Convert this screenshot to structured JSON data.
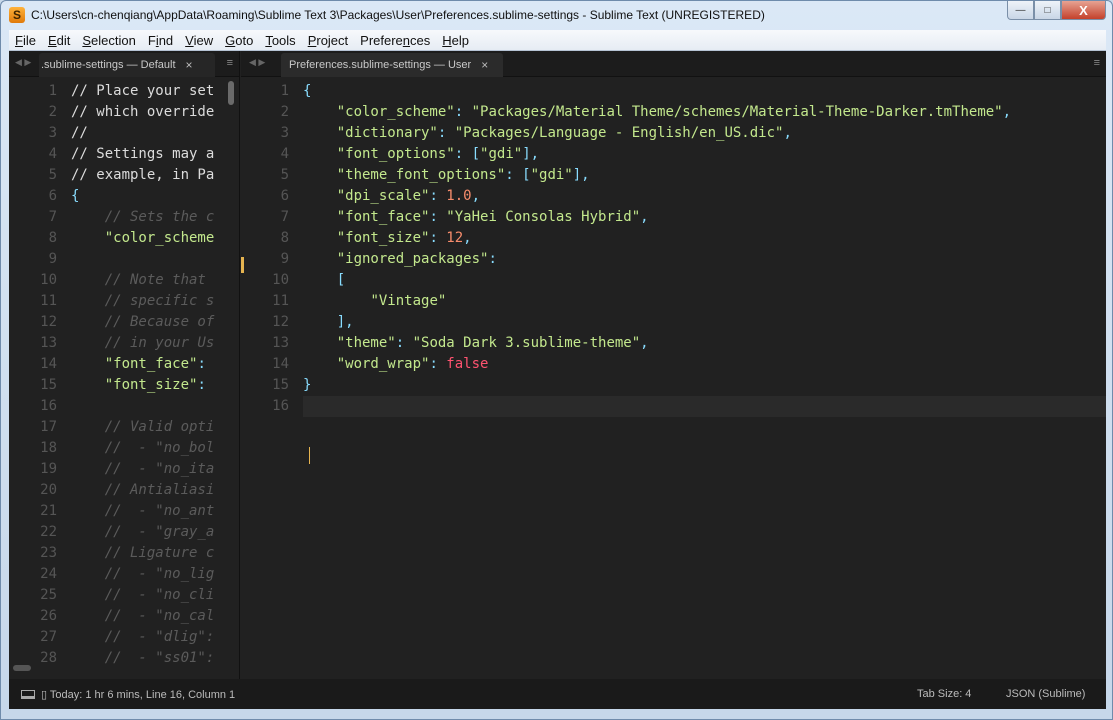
{
  "window": {
    "title": "C:\\Users\\cn-chenqiang\\AppData\\Roaming\\Sublime Text 3\\Packages\\User\\Preferences.sublime-settings - Sublime Text (UNREGISTERED)",
    "app_icon_letter": "S",
    "minimize_label": "—",
    "maximize_label": "□",
    "close_label": "X"
  },
  "menu": [
    {
      "ul": "F",
      "rest": "ile"
    },
    {
      "ul": "E",
      "rest": "dit"
    },
    {
      "ul": "S",
      "rest": "election"
    },
    {
      "pre": "F",
      "ul": "i",
      "rest": "nd"
    },
    {
      "ul": "V",
      "rest": "iew"
    },
    {
      "ul": "G",
      "rest": "oto"
    },
    {
      "ul": "T",
      "rest": "ools"
    },
    {
      "ul": "P",
      "rest": "roject"
    },
    {
      "pre": "Prefere",
      "ul": "n",
      "rest": "ces"
    },
    {
      "ul": "H",
      "rest": "elp"
    }
  ],
  "left_pane": {
    "tab_label": ".sublime-settings — Default",
    "tab_close": "×",
    "nav": "◀ ▶",
    "menu_icon": "≡",
    "line_numbers": [
      "1",
      "2",
      "3",
      "4",
      "5",
      "6",
      "7",
      "8",
      "9",
      "10",
      "11",
      "12",
      "13",
      "14",
      "15",
      "16",
      "17",
      "18",
      "19",
      "20",
      "21",
      "22",
      "23",
      "24",
      "25",
      "26",
      "27",
      "28"
    ],
    "lines": [
      [
        {
          "t": "// Place your set",
          "c": "commentplain"
        }
      ],
      [
        {
          "t": "// which override",
          "c": "commentplain"
        }
      ],
      [
        {
          "t": "//",
          "c": "commentplain"
        }
      ],
      [
        {
          "t": "// Settings may a",
          "c": "commentplain"
        }
      ],
      [
        {
          "t": "// example, in Pa",
          "c": "commentplain"
        }
      ],
      [
        {
          "t": "{",
          "c": "punct"
        }
      ],
      [
        {
          "t": "    // Sets the c",
          "c": "comment"
        }
      ],
      [
        {
          "t": "    ",
          "c": "text"
        },
        {
          "t": "\"color_scheme",
          "c": "string"
        }
      ],
      [
        {
          "t": "",
          "c": "text"
        }
      ],
      [
        {
          "t": "    // Note that ",
          "c": "comment"
        }
      ],
      [
        {
          "t": "    // specific s",
          "c": "comment"
        }
      ],
      [
        {
          "t": "    // Because of",
          "c": "comment"
        }
      ],
      [
        {
          "t": "    // in your Us",
          "c": "comment"
        }
      ],
      [
        {
          "t": "    ",
          "c": "text"
        },
        {
          "t": "\"font_face\"",
          "c": "string"
        },
        {
          "t": ":",
          "c": "punct"
        }
      ],
      [
        {
          "t": "    ",
          "c": "text"
        },
        {
          "t": "\"font_size\"",
          "c": "string"
        },
        {
          "t": ":",
          "c": "punct"
        }
      ],
      [
        {
          "t": "",
          "c": "text"
        }
      ],
      [
        {
          "t": "    // Valid opti",
          "c": "comment"
        }
      ],
      [
        {
          "t": "    //  - \"no_bol",
          "c": "comment"
        }
      ],
      [
        {
          "t": "    //  - \"no_ita",
          "c": "comment"
        }
      ],
      [
        {
          "t": "    // Antialiasi",
          "c": "comment"
        }
      ],
      [
        {
          "t": "    //  - \"no_ant",
          "c": "comment"
        }
      ],
      [
        {
          "t": "    //  - \"gray_a",
          "c": "comment"
        }
      ],
      [
        {
          "t": "    // Ligature c",
          "c": "comment"
        }
      ],
      [
        {
          "t": "    //  - \"no_lig",
          "c": "comment"
        }
      ],
      [
        {
          "t": "    //  - \"no_cli",
          "c": "comment"
        }
      ],
      [
        {
          "t": "    //  - \"no_cal",
          "c": "comment"
        }
      ],
      [
        {
          "t": "    //  - \"dlig\":",
          "c": "comment"
        }
      ],
      [
        {
          "t": "    //  - \"ss01\":",
          "c": "comment"
        }
      ]
    ]
  },
  "right_pane": {
    "tab_label": "Preferences.sublime-settings — User",
    "tab_close": "×",
    "nav": "◀ ▶",
    "menu_icon": "≡",
    "line_numbers": [
      "1",
      "2",
      "3",
      "4",
      "5",
      "6",
      "7",
      "8",
      "9",
      "10",
      "11",
      "12",
      "13",
      "14",
      "15",
      "16"
    ],
    "current_line": 16,
    "lines": [
      [
        {
          "t": "{",
          "c": "punct"
        }
      ],
      [
        {
          "t": "    ",
          "c": "text"
        },
        {
          "t": "\"color_scheme\"",
          "c": "string"
        },
        {
          "t": ": ",
          "c": "punct"
        },
        {
          "t": "\"Packages/Material Theme/schemes/Material-Theme-Darker.tmTheme\"",
          "c": "string"
        },
        {
          "t": ",",
          "c": "punct"
        }
      ],
      [
        {
          "t": "    ",
          "c": "text"
        },
        {
          "t": "\"dictionary\"",
          "c": "string"
        },
        {
          "t": ": ",
          "c": "punct"
        },
        {
          "t": "\"Packages/Language - English/en_US.dic\"",
          "c": "string"
        },
        {
          "t": ",",
          "c": "punct"
        }
      ],
      [
        {
          "t": "    ",
          "c": "text"
        },
        {
          "t": "\"font_options\"",
          "c": "string"
        },
        {
          "t": ": [",
          "c": "punct"
        },
        {
          "t": "\"gdi\"",
          "c": "string"
        },
        {
          "t": "],",
          "c": "punct"
        }
      ],
      [
        {
          "t": "    ",
          "c": "text"
        },
        {
          "t": "\"theme_font_options\"",
          "c": "string"
        },
        {
          "t": ": [",
          "c": "punct"
        },
        {
          "t": "\"gdi\"",
          "c": "string"
        },
        {
          "t": "],",
          "c": "punct"
        }
      ],
      [
        {
          "t": "    ",
          "c": "text"
        },
        {
          "t": "\"dpi_scale\"",
          "c": "string"
        },
        {
          "t": ": ",
          "c": "punct"
        },
        {
          "t": "1.0",
          "c": "number"
        },
        {
          "t": ",",
          "c": "punct"
        }
      ],
      [
        {
          "t": "    ",
          "c": "text"
        },
        {
          "t": "\"font_face\"",
          "c": "string"
        },
        {
          "t": ": ",
          "c": "punct"
        },
        {
          "t": "\"YaHei Consolas Hybrid\"",
          "c": "string"
        },
        {
          "t": ",",
          "c": "punct"
        }
      ],
      [
        {
          "t": "    ",
          "c": "text"
        },
        {
          "t": "\"font_size\"",
          "c": "string"
        },
        {
          "t": ": ",
          "c": "punct"
        },
        {
          "t": "12",
          "c": "number"
        },
        {
          "t": ",",
          "c": "punct"
        }
      ],
      [
        {
          "t": "    ",
          "c": "text"
        },
        {
          "t": "\"ignored_packages\"",
          "c": "string"
        },
        {
          "t": ":",
          "c": "punct"
        }
      ],
      [
        {
          "t": "    ",
          "c": "text"
        },
        {
          "t": "[",
          "c": "punct"
        }
      ],
      [
        {
          "t": "        ",
          "c": "text"
        },
        {
          "t": "\"Vintage\"",
          "c": "string"
        }
      ],
      [
        {
          "t": "    ",
          "c": "text"
        },
        {
          "t": "],",
          "c": "punct"
        }
      ],
      [
        {
          "t": "    ",
          "c": "text"
        },
        {
          "t": "\"theme\"",
          "c": "string"
        },
        {
          "t": ": ",
          "c": "punct"
        },
        {
          "t": "\"Soda Dark 3.sublime-theme\"",
          "c": "string"
        },
        {
          "t": ",",
          "c": "punct"
        }
      ],
      [
        {
          "t": "    ",
          "c": "text"
        },
        {
          "t": "\"word_wrap\"",
          "c": "string"
        },
        {
          "t": ": ",
          "c": "punct"
        },
        {
          "t": "false",
          "c": "bool"
        }
      ],
      [
        {
          "t": "}",
          "c": "punct"
        }
      ],
      [
        {
          "t": "",
          "c": "text"
        }
      ]
    ]
  },
  "statusbar": {
    "panel_icon": "panel-toggle-icon",
    "left_text": "▯ Today: 1 hr 6 mins, Line 16, Column 1",
    "tab_size": "Tab Size: 4",
    "syntax": "JSON (Sublime)"
  }
}
